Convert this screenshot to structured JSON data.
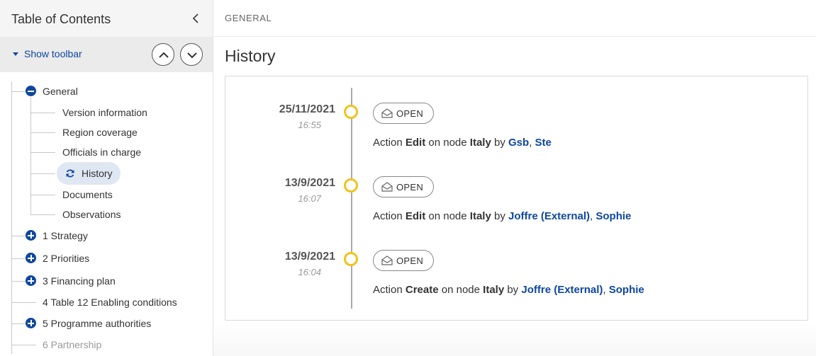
{
  "sidebar": {
    "title": "Table of Contents",
    "show_toolbar": "Show toolbar",
    "tree": {
      "general": "General",
      "children": [
        "Version information",
        "Region coverage",
        "Officials in charge",
        "History",
        "Documents",
        "Observations"
      ],
      "sections": [
        "1 Strategy",
        "2 Priorities",
        "3 Financing plan",
        "4 Table 12 Enabling conditions",
        "5 Programme authorities",
        "6 Partnership"
      ]
    }
  },
  "main": {
    "breadcrumb": "GENERAL",
    "title": "History",
    "entries": [
      {
        "date": "25/11/2021",
        "time": "16:55",
        "badge": "OPEN",
        "action_prefix": "Action",
        "action": "Edit",
        "node_prefix": "on node",
        "node": "Italy",
        "by": "by",
        "user1": "Gsb",
        "sep": ",",
        "user2": "Ste"
      },
      {
        "date": "13/9/2021",
        "time": "16:07",
        "badge": "OPEN",
        "action_prefix": "Action",
        "action": "Edit",
        "node_prefix": "on node",
        "node": "Italy",
        "by": "by",
        "user1": "Joffre (External)",
        "sep": ",",
        "user2": "Sophie"
      },
      {
        "date": "13/9/2021",
        "time": "16:04",
        "badge": "OPEN",
        "action_prefix": "Action",
        "action": "Create",
        "node_prefix": "on node",
        "node": "Italy",
        "by": "by",
        "user1": "Joffre (External)",
        "sep": ",",
        "user2": "Sophie"
      }
    ]
  },
  "colors": {
    "accent": "#0e47a1",
    "timeline_dot": "#f2c21c"
  },
  "icons": [
    "chevron-left-icon",
    "caret-down-icon",
    "chevron-up-icon",
    "chevron-down-icon",
    "minus-circle-icon",
    "plus-circle-icon",
    "refresh-icon",
    "envelope-open-icon"
  ]
}
